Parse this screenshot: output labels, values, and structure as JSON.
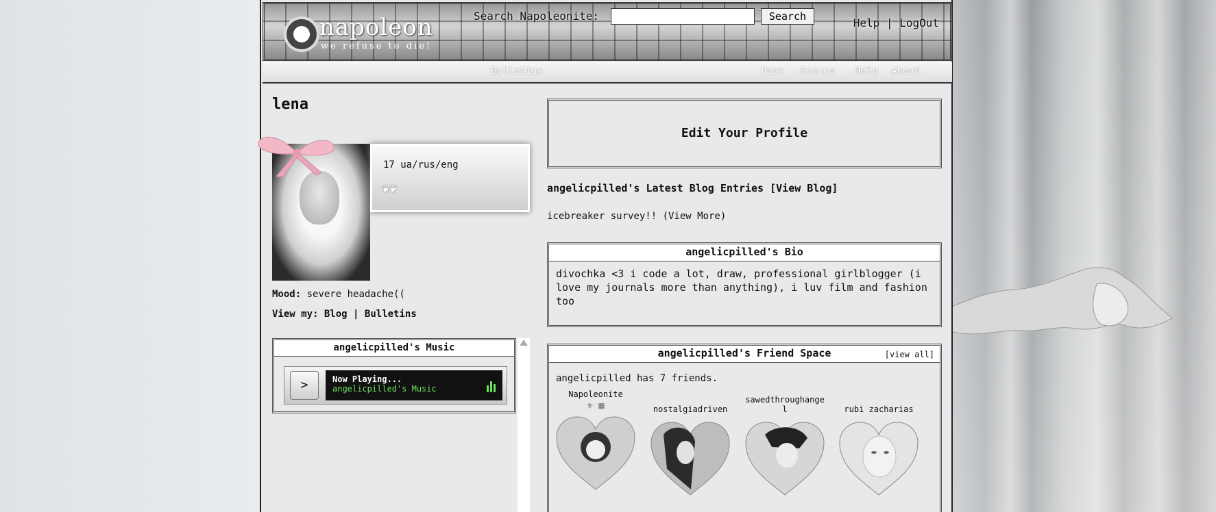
{
  "header": {
    "logo_text": "napoleon",
    "logo_tagline": "we refuse to die!",
    "search_label": "Search Napoleonite:",
    "search_button": "Search",
    "help_link": "Help",
    "separator": "|",
    "logout_link": "LogOut"
  },
  "nav": {
    "items": [
      "Bulletins",
      "Favs",
      "Source",
      "Help",
      "About"
    ]
  },
  "profile": {
    "username": "lena",
    "info_text": "17 ua/rus/eng",
    "mood_label": "Mood:",
    "mood_value": "severe headache((",
    "viewmy_label": "View my:",
    "blog_link": "Blog",
    "separator": "|",
    "bulletins_link": "Bulletins"
  },
  "music": {
    "title": "angelicpilled's Music",
    "play_symbol": ">",
    "now_playing": "Now Playing...",
    "track": "angelicpilled's Music"
  },
  "right": {
    "edit_profile": "Edit Your Profile",
    "latest_title": "angelicpilled's Latest Blog Entries [View Blog]",
    "blog_entry": "icebreaker survey!! (View More)",
    "bio_title": "angelicpilled's Bio",
    "bio_text": "divochka <3 i code a lot, draw, professional girlblogger (i love my journals more than anything), i luv film and fashion too",
    "friends_title": "angelicpilled's Friend Space",
    "view_all": "[view all]",
    "friend_count": "angelicpilled has 7 friends.",
    "friends": [
      {
        "name": "Napoleonite"
      },
      {
        "name": "nostalgiadriven"
      },
      {
        "name": "sawedthroughangel"
      },
      {
        "name": "rubi zacharias"
      }
    ]
  },
  "colors": {
    "now_playing_green": "#6be35b",
    "ribbon_pink": "#f2b8c6"
  }
}
